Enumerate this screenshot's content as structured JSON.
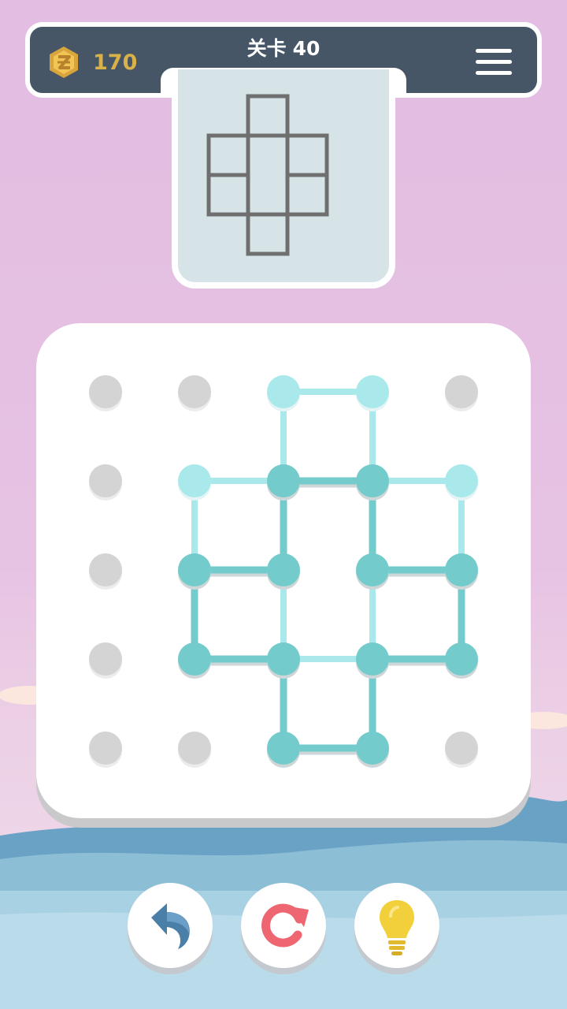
{
  "header": {
    "coin_icon": "coin-z-icon",
    "coins": "170",
    "level_label": "关卡",
    "level_number": "40",
    "menu_icon": "hamburger-menu-icon"
  },
  "puzzle": {
    "grid_size": 5,
    "target_edges": [
      [
        [
          2,
          0
        ],
        [
          3,
          0
        ]
      ],
      [
        [
          2,
          0
        ],
        [
          2,
          1
        ]
      ],
      [
        [
          3,
          0
        ],
        [
          3,
          1
        ]
      ],
      [
        [
          1,
          1
        ],
        [
          2,
          1
        ]
      ],
      [
        [
          2,
          1
        ],
        [
          3,
          1
        ]
      ],
      [
        [
          3,
          1
        ],
        [
          4,
          1
        ]
      ],
      [
        [
          1,
          1
        ],
        [
          1,
          2
        ]
      ],
      [
        [
          2,
          1
        ],
        [
          2,
          2
        ]
      ],
      [
        [
          3,
          1
        ],
        [
          3,
          2
        ]
      ],
      [
        [
          4,
          1
        ],
        [
          4,
          2
        ]
      ],
      [
        [
          1,
          2
        ],
        [
          2,
          2
        ]
      ],
      [
        [
          3,
          2
        ],
        [
          4,
          2
        ]
      ],
      [
        [
          1,
          2
        ],
        [
          1,
          3
        ]
      ],
      [
        [
          2,
          2
        ],
        [
          2,
          3
        ]
      ],
      [
        [
          3,
          2
        ],
        [
          3,
          3
        ]
      ],
      [
        [
          4,
          2
        ],
        [
          4,
          3
        ]
      ],
      [
        [
          1,
          3
        ],
        [
          2,
          3
        ]
      ],
      [
        [
          2,
          3
        ],
        [
          3,
          3
        ]
      ],
      [
        [
          3,
          3
        ],
        [
          4,
          3
        ]
      ],
      [
        [
          2,
          3
        ],
        [
          2,
          4
        ]
      ],
      [
        [
          3,
          3
        ],
        [
          3,
          4
        ]
      ],
      [
        [
          2,
          4
        ],
        [
          3,
          4
        ]
      ]
    ],
    "drawn_edges": [
      [
        [
          1,
          2
        ],
        [
          2,
          2
        ]
      ],
      [
        [
          2,
          1
        ],
        [
          2,
          2
        ]
      ],
      [
        [
          2,
          1
        ],
        [
          3,
          1
        ]
      ],
      [
        [
          3,
          1
        ],
        [
          3,
          2
        ]
      ],
      [
        [
          3,
          2
        ],
        [
          4,
          2
        ]
      ],
      [
        [
          4,
          2
        ],
        [
          4,
          3
        ]
      ],
      [
        [
          4,
          3
        ],
        [
          3,
          3
        ]
      ],
      [
        [
          3,
          3
        ],
        [
          3,
          4
        ]
      ],
      [
        [
          3,
          4
        ],
        [
          2,
          4
        ]
      ],
      [
        [
          2,
          4
        ],
        [
          2,
          3
        ]
      ],
      [
        [
          2,
          3
        ],
        [
          1,
          3
        ]
      ],
      [
        [
          1,
          3
        ],
        [
          1,
          2
        ]
      ]
    ],
    "dot_states": [
      [
        "inactive",
        "inactive",
        "hint",
        "hint",
        "inactive"
      ],
      [
        "inactive",
        "hint",
        "active",
        "active",
        "hint"
      ],
      [
        "inactive",
        "active",
        "active",
        "active",
        "active"
      ],
      [
        "inactive",
        "active",
        "active",
        "active",
        "active"
      ],
      [
        "inactive",
        "inactive",
        "active",
        "active",
        "inactive"
      ]
    ]
  },
  "controls": [
    {
      "name": "undo-button",
      "icon": "undo-arrow-icon"
    },
    {
      "name": "restart-button",
      "icon": "restart-icon"
    },
    {
      "name": "hint-button",
      "icon": "lightbulb-icon"
    }
  ],
  "colors": {
    "header_bg": "#465667",
    "coin_text": "#d8b148",
    "line_active": "#73cbcc",
    "line_hint": "#a9e9ec",
    "dot_inactive": "#d4d4d4",
    "preview_bg": "#d7e4e7",
    "preview_line": "#6f6f6f",
    "undo_icon": "#4a7fa8",
    "restart_icon": "#ee6671",
    "hint_icon": "#f2d03b"
  }
}
